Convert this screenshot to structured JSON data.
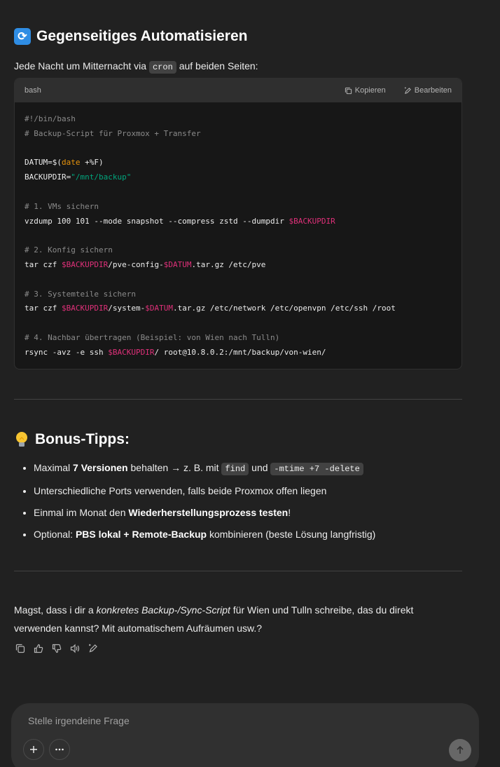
{
  "section1": {
    "emoji_icon": "arrows-cycle-icon",
    "heading": "Gegenseitiges Automatisieren",
    "intro_before": "Jede Nacht um Mitternacht via",
    "intro_code": "cron",
    "intro_after": "auf beiden Seiten:"
  },
  "codeblock": {
    "language": "bash",
    "copy_label": "Kopieren",
    "edit_label": "Bearbeiten",
    "lines": [
      "#!/bin/bash",
      "# Backup-Script für Proxmox + Transfer",
      "",
      "DATUM=$(date +%F)",
      "BACKUPDIR=\"/mnt/backup\"",
      "",
      "# 1. VMs sichern",
      "vzdump 100 101 --mode snapshot --compress zstd --dumpdir $BACKUPDIR",
      "",
      "# 2. Konfig sichern",
      "tar czf $BACKUPDIR/pve-config-$DATUM.tar.gz /etc/pve",
      "",
      "# 3. Systemteile sichern",
      "tar czf $BACKUPDIR/system-$DATUM.tar.gz /etc/network /etc/openvpn /etc/ssh /root",
      "",
      "# 4. Nachbar übertragen (Beispiel: von Wien nach Tulln)",
      "rsync -avz -e ssh $BACKUPDIR/ root@10.8.0.2:/mnt/backup/von-wien/"
    ]
  },
  "section2": {
    "heading": "Bonus-Tipps:",
    "tip1": {
      "before": "Maximal ",
      "bold": "7 Versionen",
      "middle": " behalten → z. B. mit ",
      "code1": "find",
      "and": " und ",
      "code2": "-mtime +7 -delete"
    },
    "tip2": {
      "text": "Unterschiedliche Ports verwenden, falls beide Proxmox offen liegen"
    },
    "tip3": {
      "before": "Einmal im Monat den ",
      "bold": "Wiederherstellungsprozess testen",
      "after": "!"
    },
    "tip4": {
      "before": "Optional: ",
      "bold1": "PBS lokal",
      "mid": " + ",
      "bold2": "Remote-Backup",
      "after": " kombinieren (beste Lösung langfristig)"
    }
  },
  "closing": {
    "before": "Magst, dass i dir a ",
    "italic": "konkretes Backup-/Sync-Script",
    "after": " für Wien und Tulln schreibe, das du direkt verwenden kannst? Mit automatischem Aufräumen usw.?"
  },
  "composer": {
    "placeholder": "Stelle irgendeine Frage"
  },
  "colors": {
    "background": "#212121",
    "code_bg": "#171717",
    "comment": "#8b8b8b",
    "string": "#00a67d",
    "variable": "#df3079",
    "builtin": "#e9950c"
  }
}
